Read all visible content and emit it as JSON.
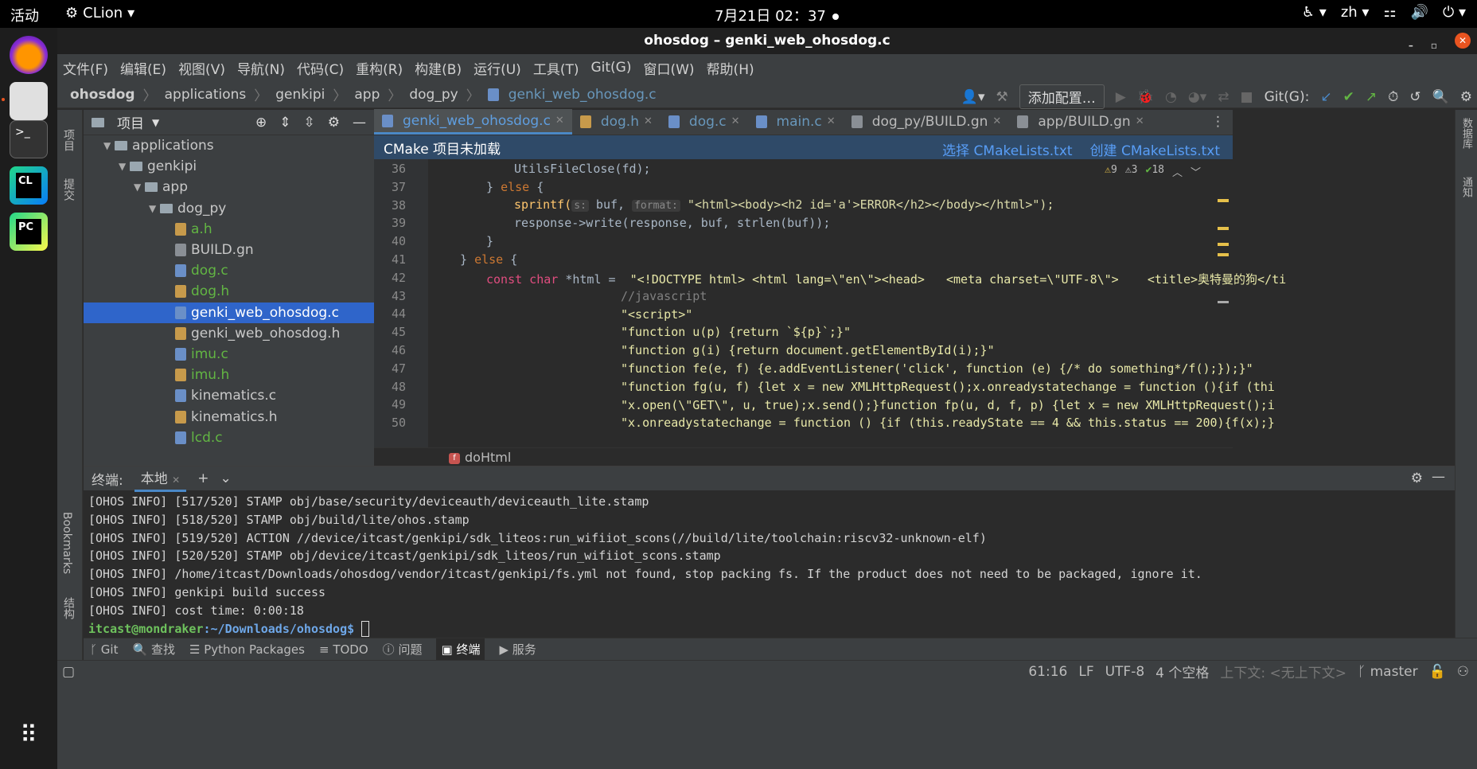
{
  "topbar": {
    "activities": "活动",
    "app_name": "CLion",
    "clock": "7月21日 02：37",
    "input_method": "zh"
  },
  "window": {
    "title": "ohosdog – genki_web_ohosdog.c"
  },
  "menu": [
    "文件(F)",
    "编辑(E)",
    "视图(V)",
    "导航(N)",
    "代码(C)",
    "重构(R)",
    "构建(B)",
    "运行(U)",
    "工具(T)",
    "Git(G)",
    "窗口(W)",
    "帮助(H)"
  ],
  "navbar": {
    "crumbs": [
      "ohosdog",
      "applications",
      "genkipi",
      "app",
      "dog_py",
      "genki_web_ohosdog.c"
    ],
    "add_config": "添加配置…",
    "git_label": "Git(G):"
  },
  "left_strip": {
    "project": "项目",
    "commit": "提交",
    "bookmarks": "Bookmarks",
    "structure": "结构"
  },
  "right_strip": {
    "database": "数据库",
    "notifications": "通知"
  },
  "project_panel": {
    "title": "项目",
    "tree": [
      {
        "label": "applications",
        "type": "folder",
        "depth": 1
      },
      {
        "label": "genkipi",
        "type": "folder",
        "depth": 2
      },
      {
        "label": "app",
        "type": "folder",
        "depth": 3
      },
      {
        "label": "dog_py",
        "type": "folder",
        "depth": 4
      },
      {
        "label": "a.h",
        "type": "h",
        "depth": 5,
        "color": "green"
      },
      {
        "label": "BUILD.gn",
        "type": "gn",
        "depth": 5,
        "color": "plain"
      },
      {
        "label": "dog.c",
        "type": "c",
        "depth": 5,
        "color": "green"
      },
      {
        "label": "dog.h",
        "type": "h",
        "depth": 5,
        "color": "green"
      },
      {
        "label": "genki_web_ohosdog.c",
        "type": "c",
        "depth": 5,
        "color": "selected"
      },
      {
        "label": "genki_web_ohosdog.h",
        "type": "h",
        "depth": 5,
        "color": "plain"
      },
      {
        "label": "imu.c",
        "type": "c",
        "depth": 5,
        "color": "green"
      },
      {
        "label": "imu.h",
        "type": "h",
        "depth": 5,
        "color": "green"
      },
      {
        "label": "kinematics.c",
        "type": "c",
        "depth": 5,
        "color": "plain"
      },
      {
        "label": "kinematics.h",
        "type": "h",
        "depth": 5,
        "color": "plain"
      },
      {
        "label": "lcd.c",
        "type": "c",
        "depth": 5,
        "color": "green"
      }
    ]
  },
  "editor": {
    "tabs": [
      {
        "label": "genki_web_ohosdog.c",
        "active": true
      },
      {
        "label": "dog.h",
        "active": false
      },
      {
        "label": "dog.c",
        "active": false
      },
      {
        "label": "main.c",
        "active": false
      },
      {
        "label": "dog_py/BUILD.gn",
        "active": false
      },
      {
        "label": "app/BUILD.gn",
        "active": false
      }
    ],
    "banner": {
      "message": "CMake 项目未加载",
      "select_link": "选择 CMakeLists.txt",
      "create_link": "创建 CMakeLists.txt"
    },
    "inspections": {
      "warnings": "9",
      "weak_warnings": "3",
      "typos": "18"
    },
    "line_numbers": [
      "36",
      "37",
      "38",
      "39",
      "40",
      "41",
      "42",
      "43",
      "44",
      "45",
      "46",
      "47",
      "48",
      "49",
      "50"
    ],
    "lines": {
      "l36": "UtilsFileClose(fd);",
      "l37_a": "} ",
      "l37_kw": "else",
      "l37_b": " {",
      "l38_fn": "sprintf(",
      "l38_hint1": "s:",
      "l38_a": " buf, ",
      "l38_hint2": "format:",
      "l38_str": " \"<html><body><h2 id='a'>ERROR</h2></body></html>\");",
      "l39": "response->write(response, buf, strlen(buf));",
      "l40": "}",
      "l41_a": "} ",
      "l41_kw": "else",
      "l41_b": " {",
      "l42_kw": "const char ",
      "l42_a": "*html = ",
      "l42_str": " \"<!DOCTYPE html> <html lang=\\\"en\\\"><head>   <meta charset=\\\"UTF-8\\\">    <title>奥特曼的狗</ti",
      "l43": "//javascript",
      "l44": "\"<script>\"",
      "l45": "\"function u(p) {return `${p}`;}\"",
      "l46": "\"function g(i) {return document.getElementById(i);}\"",
      "l47": "\"function fe(e, f) {e.addEventListener('click', function (e) {/* do something*/f();});}\"",
      "l48": "\"function fg(u, f) {let x = new XMLHttpRequest();x.onreadystatechange = function (){if (thi",
      "l49": "\"x.open(\\\"GET\\\", u, true);x.send();}function fp(u, d, f, p) {let x = new XMLHttpRequest();i",
      "l50": "\"x.onreadystatechange = function () {if (this.readyState == 4 && this.status == 200){f(x);}"
    },
    "function_crumb": "doHtml"
  },
  "terminal": {
    "label": "终端:",
    "tab": "本地",
    "lines": [
      "[OHOS INFO] [517/520] STAMP obj/base/security/deviceauth/deviceauth_lite.stamp",
      "[OHOS INFO] [518/520] STAMP obj/build/lite/ohos.stamp",
      "[OHOS INFO] [519/520] ACTION //device/itcast/genkipi/sdk_liteos:run_wifiiot_scons(//build/lite/toolchain:riscv32-unknown-elf)",
      "[OHOS INFO] [520/520] STAMP obj/device/itcast/genkipi/sdk_liteos/run_wifiiot_scons.stamp",
      "[OHOS INFO] /home/itcast/Downloads/ohosdog/vendor/itcast/genkipi/fs.yml not found, stop packing fs. If the product does not need to be packaged, ignore it.",
      "[OHOS INFO] genkipi build success",
      "[OHOS INFO] cost time: 0:00:18"
    ],
    "prompt_user": "itcast@mondraker",
    "prompt_path": ":~/Downloads/ohosdog$"
  },
  "toolstrip": [
    "Git",
    "查找",
    "Python Packages",
    "TODO",
    "问题",
    "终端",
    "服务"
  ],
  "status": {
    "position": "61:16",
    "line_sep": "LF",
    "encoding": "UTF-8",
    "indent": "4 个空格",
    "context": "上下文: <无上下文>",
    "branch": "master"
  },
  "colors": {
    "accent": "#2f65ca",
    "link": "#589df6",
    "ubuntu_orange": "#e95420"
  }
}
